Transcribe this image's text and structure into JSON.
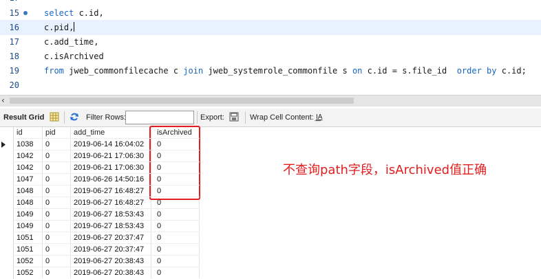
{
  "editor": {
    "lines": [
      {
        "num": "17",
        "code": ""
      },
      {
        "num": "15",
        "code": "select c.id,",
        "kw": [
          "select"
        ],
        "dot": true
      },
      {
        "num": "16",
        "code": "c.pid,",
        "cursor": true,
        "current": true
      },
      {
        "num": "17",
        "code": "c.add_time,"
      },
      {
        "num": "18",
        "code": "c.isArchived"
      },
      {
        "num": "19",
        "code": "from jweb_commonfilecache c join jweb_systemrole_commonfile s on c.id = s.file_id  order by c.id;"
      },
      {
        "num": "20",
        "code": ""
      }
    ]
  },
  "toolbar": {
    "result_grid": "Result Grid",
    "filter_rows": "Filter Rows:",
    "filter_value": "",
    "export": "Export:",
    "wrap": "Wrap Cell Content:",
    "wrap_icon_glyph": "I͟A"
  },
  "grid": {
    "columns": [
      "id",
      "pid",
      "add_time",
      "isArchived"
    ],
    "rows": [
      [
        "1038",
        "0",
        "2019-06-14 16:04:02",
        "0"
      ],
      [
        "1042",
        "0",
        "2019-06-21 17:06:30",
        "0"
      ],
      [
        "1042",
        "0",
        "2019-06-21 17:06:30",
        "0"
      ],
      [
        "1047",
        "0",
        "2019-06-26 14:50:16",
        "0"
      ],
      [
        "1048",
        "0",
        "2019-06-27 16:48:27",
        "0"
      ],
      [
        "1048",
        "0",
        "2019-06-27 16:48:27",
        "0"
      ],
      [
        "1049",
        "0",
        "2019-06-27 18:53:43",
        "0"
      ],
      [
        "1049",
        "0",
        "2019-06-27 18:53:43",
        "0"
      ],
      [
        "1051",
        "0",
        "2019-06-27 20:37:47",
        "0"
      ],
      [
        "1051",
        "0",
        "2019-06-27 20:37:47",
        "0"
      ],
      [
        "1052",
        "0",
        "2019-06-27 20:38:43",
        "0"
      ],
      [
        "1052",
        "0",
        "2019-06-27 20:38:43",
        "0"
      ]
    ],
    "selected_row": 0
  },
  "annotation": {
    "text": "不查询path字段，isArchived值正确",
    "color": "#e21d1d"
  }
}
